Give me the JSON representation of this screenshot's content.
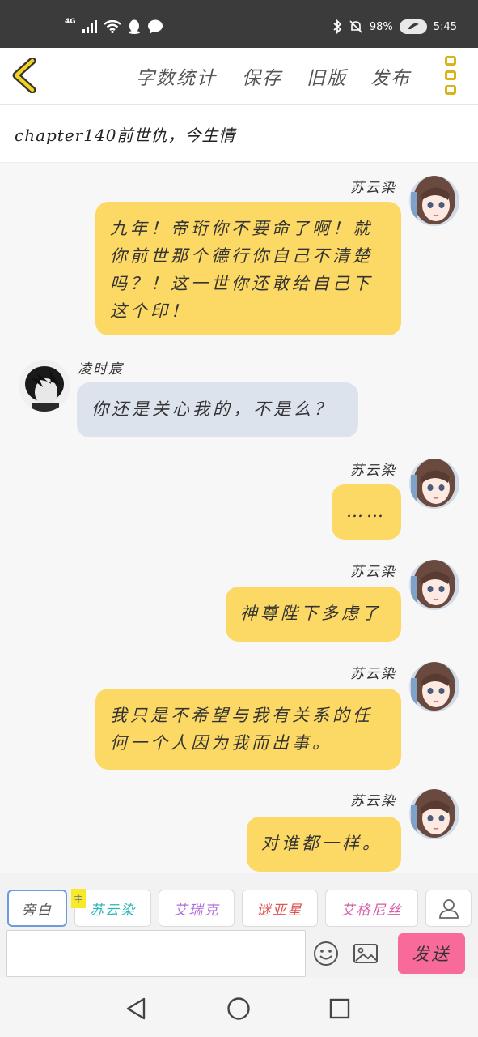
{
  "status_bar": {
    "network": "4G",
    "battery_percent": "98%",
    "time": "5:45"
  },
  "toolbar": {
    "word_count": "字数统计",
    "save": "保存",
    "old_version": "旧版",
    "publish": "发布"
  },
  "chapter": {
    "title": "chapter140前世仇，今生情"
  },
  "messages": [
    {
      "sender": "苏云染",
      "side": "right",
      "text": "九年！帝珩你不要命了啊！就你前世那个德行你自己不清楚吗？！这一世你还敢给自己下这个印！"
    },
    {
      "sender": "凌时宸",
      "side": "left",
      "text": "你还是关心我的，不是么？"
    },
    {
      "sender": "苏云染",
      "side": "right",
      "text": "……"
    },
    {
      "sender": "苏云染",
      "side": "right",
      "text": "神尊陛下多虑了"
    },
    {
      "sender": "苏云染",
      "side": "right",
      "text": "我只是不希望与我有关系的任何一个人因为我而出事。"
    },
    {
      "sender": "苏云染",
      "side": "right",
      "text": "对谁都一样。"
    }
  ],
  "composer": {
    "roles": [
      {
        "label": "旁白",
        "color": "#555555"
      },
      {
        "label": "苏云染",
        "color": "#2bb5b5"
      },
      {
        "label": "艾瑞克",
        "color": "#b070d8"
      },
      {
        "label": "谜亚星",
        "color": "#e05555"
      },
      {
        "label": "艾格尼丝",
        "color": "#d85aa6"
      }
    ],
    "main_tag": "主",
    "input_value": "",
    "send_label": "发送"
  }
}
